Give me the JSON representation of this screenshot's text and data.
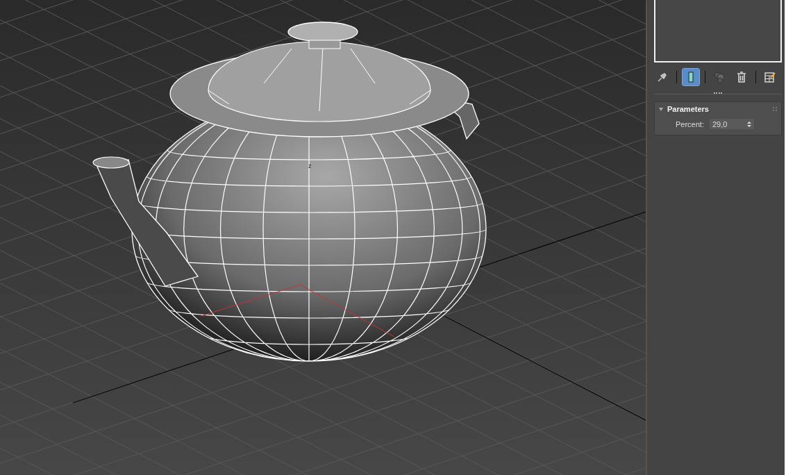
{
  "viewport": {
    "axis_label": "z"
  },
  "command_panel": {
    "toolbar": [
      {
        "kind": "pin",
        "selected": false
      },
      {
        "kind": "separator"
      },
      {
        "kind": "show-result",
        "selected": true
      },
      {
        "kind": "separator"
      },
      {
        "kind": "make-unique",
        "selected": false
      },
      {
        "kind": "remove",
        "selected": false
      },
      {
        "kind": "separator"
      },
      {
        "kind": "configure",
        "selected": false
      }
    ],
    "rollout": {
      "title": "Parameters",
      "expanded": true,
      "fields": [
        {
          "label": "Percent:",
          "value": "29,0"
        }
      ]
    }
  }
}
